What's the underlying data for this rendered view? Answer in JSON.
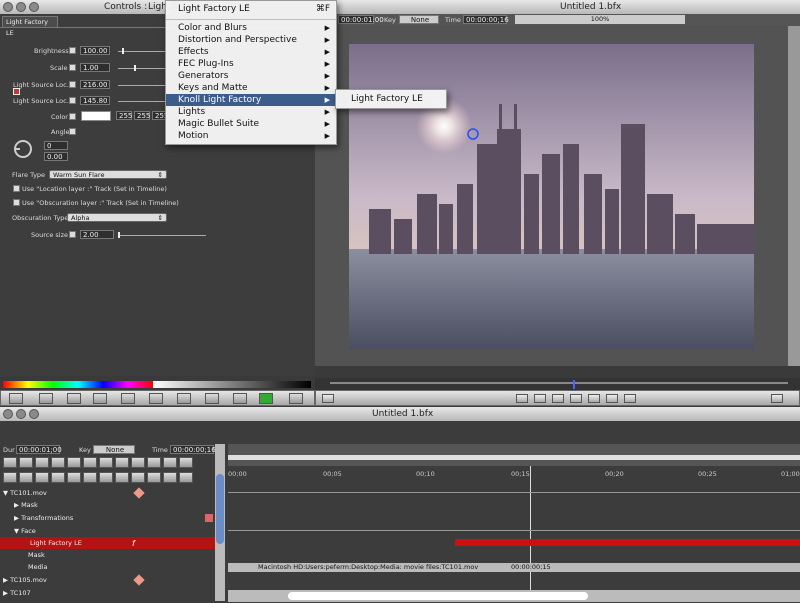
{
  "controls_window": {
    "title": "Controls :",
    "title_suffix": "Light",
    "tab": "Light Factory LE",
    "params": [
      {
        "label": "Brightness",
        "value": "100.00"
      },
      {
        "label": "Scale",
        "value": "1.00"
      },
      {
        "label": "Light Source Loc...",
        "value": "216.00"
      },
      {
        "label": "Light Source Loc...",
        "value": "145.80"
      }
    ],
    "color_label": "Color",
    "color_values": [
      "255",
      "255",
      "255"
    ],
    "angle_label": "Angle",
    "angle_values": [
      "0",
      "0.00"
    ],
    "flare_type_label": "Flare Type",
    "flare_type_value": "Warm Sun Flare",
    "use_location": "Use \"Location layer :\" Track (Set in Timeline)",
    "use_obscuration": "Use \"Obscuration layer :\" Track (Set in Timeline)",
    "obscuration_type_label": "Obscuration Type",
    "obscuration_type_value": "Alpha",
    "source_size_label": "Source size :",
    "source_size_value": "2.00"
  },
  "top_menu": {
    "title": "Light Factory LE",
    "shortcut": "⌘F",
    "items": [
      "Color and Blurs",
      "Distortion and Perspective",
      "Effects",
      "FEC Plug-Ins",
      "Generators",
      "Keys and Matte",
      "Knoll Light Factory",
      "Lights",
      "Magic Bullet Suite",
      "Motion"
    ],
    "submenu_item": "Light Factory LE"
  },
  "viewer": {
    "timecode": "00:00:01:00",
    "key_label": "Key",
    "key_value": "None",
    "time_label": "Time",
    "time_value": "00:00:00;16",
    "title": "Untitled 1.bfx",
    "zoom": "100%"
  },
  "timeline": {
    "title": "Untitled 1.bfx",
    "dur_label": "Dur",
    "dur_value": "00:00:01;00",
    "key_label": "Key",
    "key_value": "None",
    "time_label": "Time",
    "time_value": "00:00:00;16",
    "ruler": [
      "00;00",
      "00;05",
      "00;10",
      "00;15",
      "00;20",
      "00;25",
      "01;00"
    ],
    "tracks": [
      "TC101.mov",
      "Mask",
      "Transformations",
      "Face",
      "Light Factory LE",
      "Mask",
      "Media",
      "TC105.mov",
      "TC107"
    ],
    "media_path": "Macintosh HD:Users:peferm:Desktop:Media: movie files:TC101.mov",
    "media_time": "00:00:00;15"
  },
  "colors": {
    "accent": "#3c5d8c",
    "selected_track": "#b51212",
    "bg": "#3a3a3a"
  }
}
